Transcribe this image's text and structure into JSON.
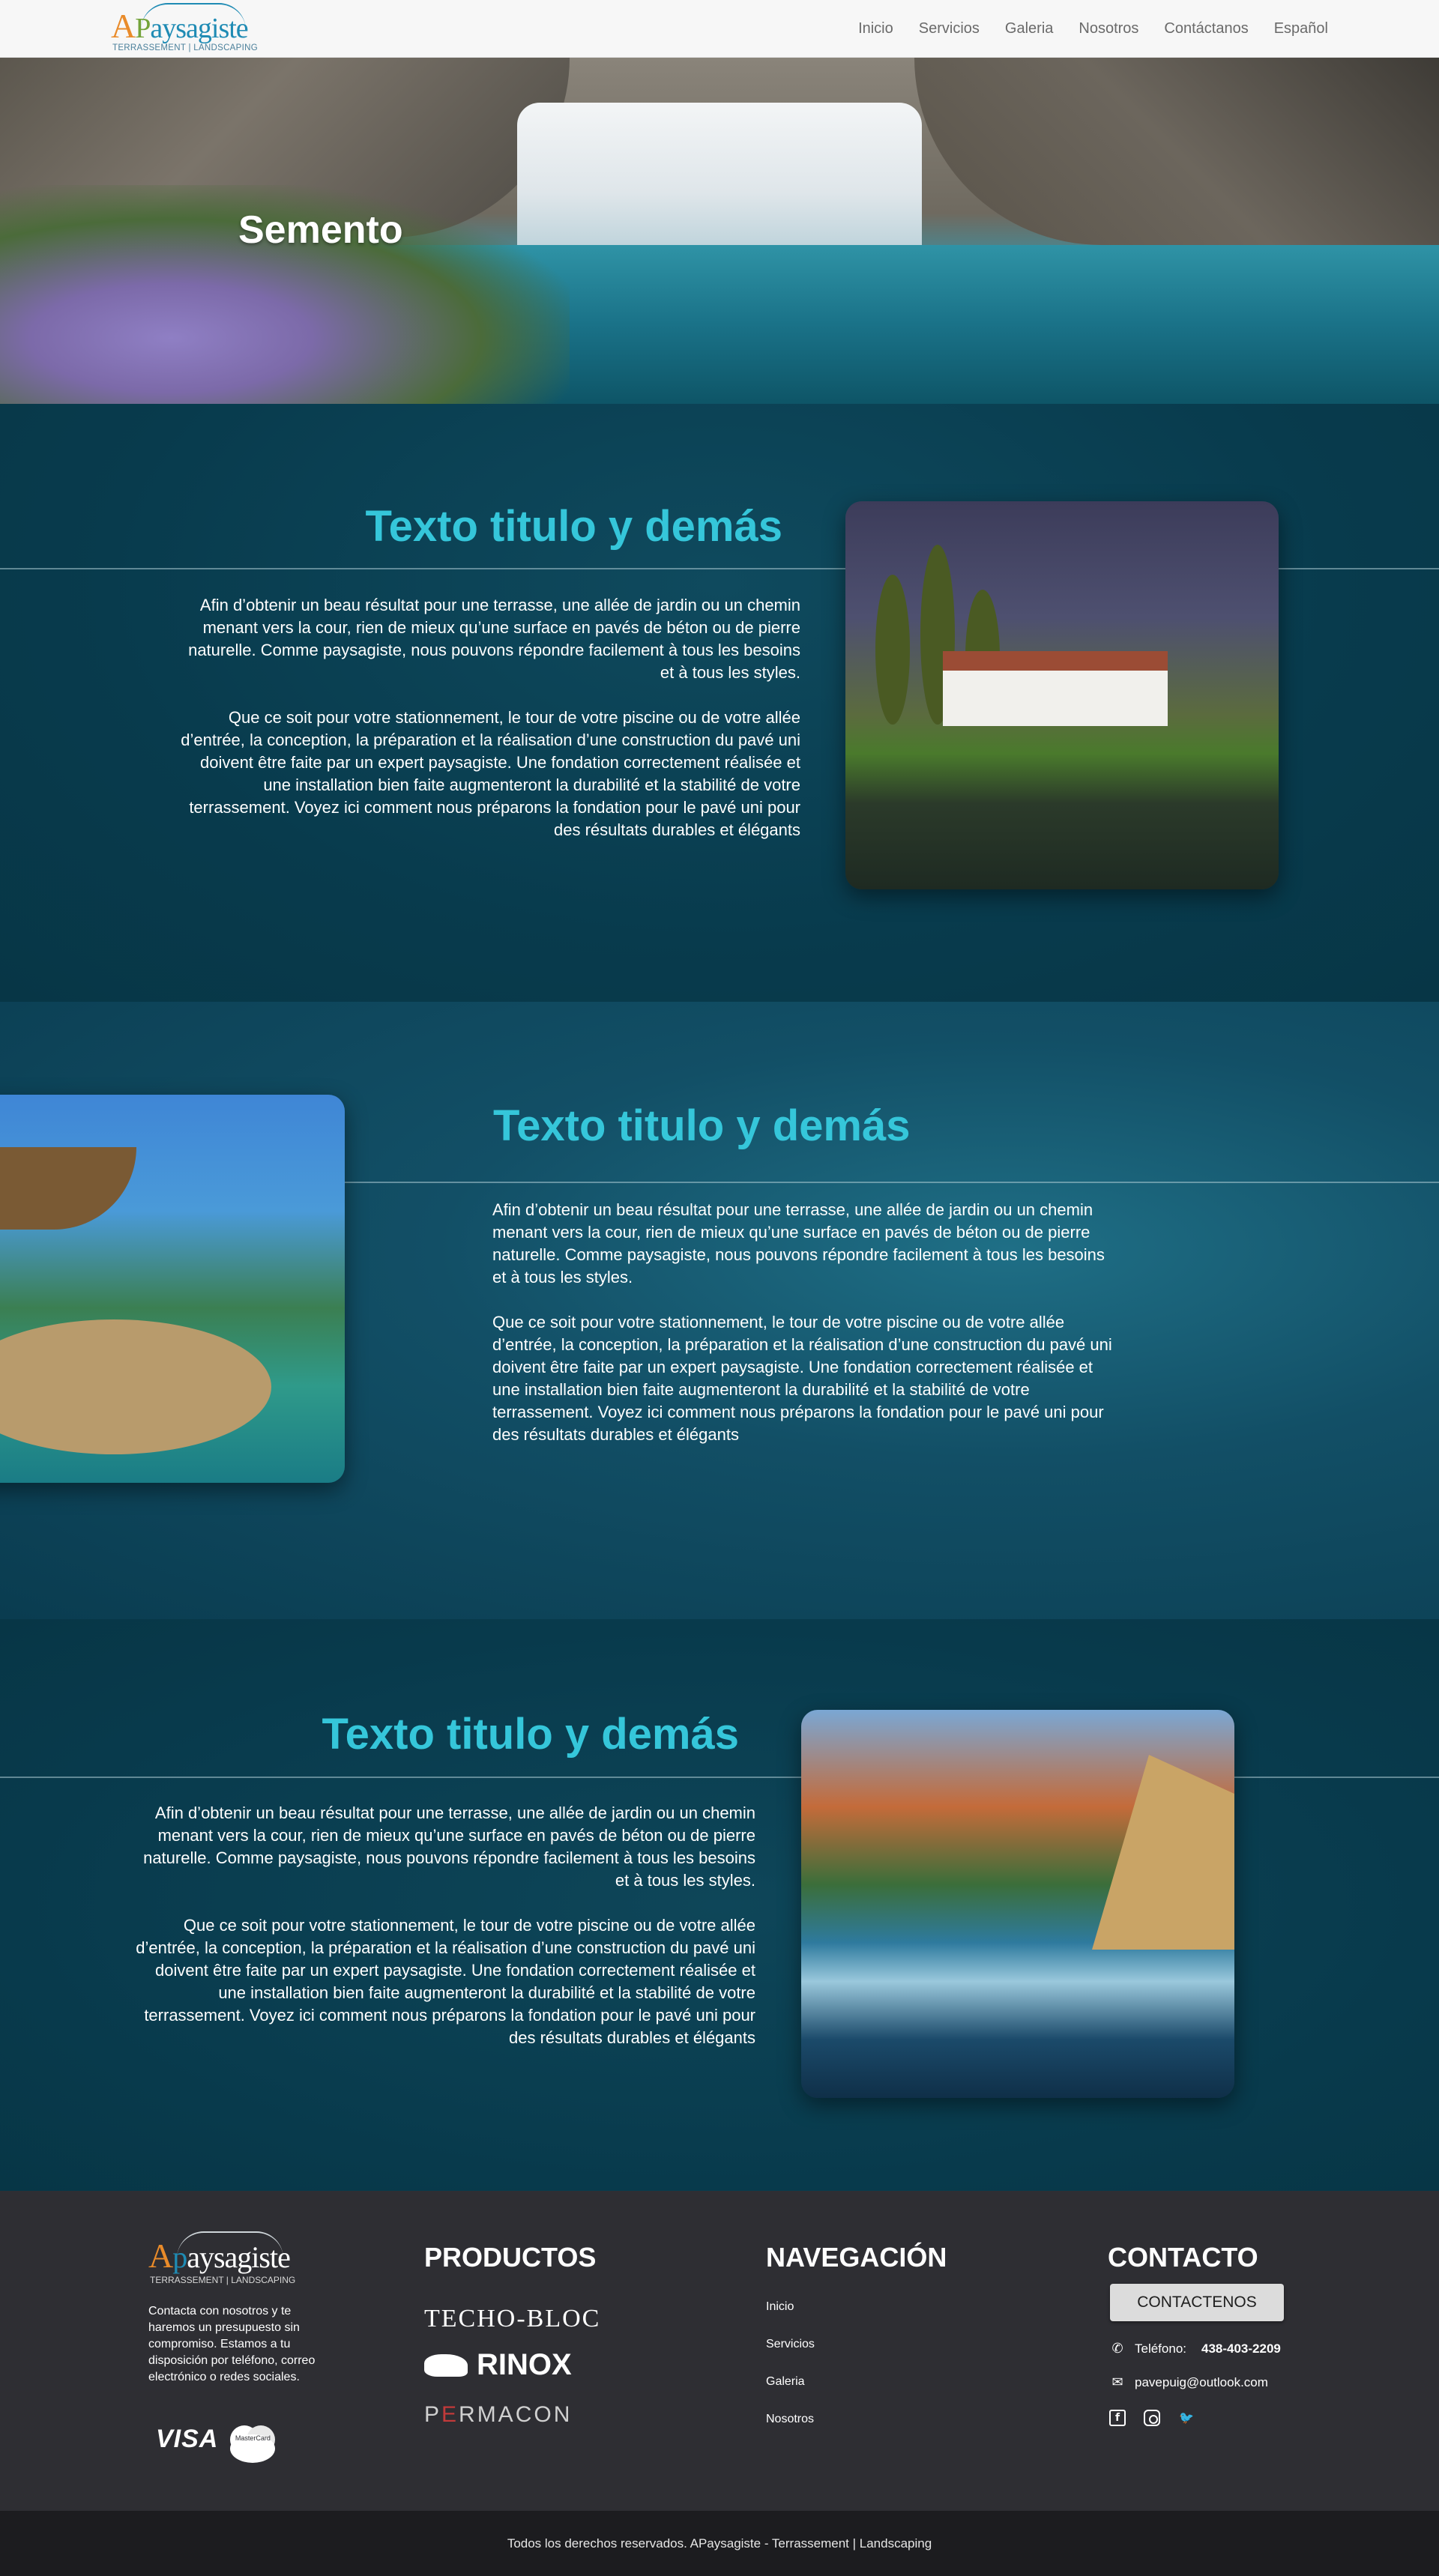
{
  "header": {
    "logo": {
      "text_a": "A",
      "text_p": "P",
      "text_rest": "aysagiste",
      "subtitle": "TERRASSEMENT | LANDSCAPING"
    },
    "nav": [
      "Inicio",
      "Servicios",
      "Galeria",
      "Nosotros",
      "Contáctanos",
      "Español"
    ]
  },
  "hero": {
    "title": "Semento"
  },
  "sections": [
    {
      "title": "Texto titulo y demás",
      "paragraphs": [
        "Afin d’obtenir un beau résultat pour une terrasse, une allée de jardin ou un chemin menant vers la cour, rien de mieux qu’une surface en pavés de béton ou de pierre naturelle. Comme paysagiste, nous pouvons répondre facilement à tous les besoins et à tous les styles.",
        "Que ce soit pour votre stationnement, le tour de votre piscine ou de votre allée d’entrée, la conception, la préparation et la réalisation d’une construction du pavé uni doivent être faite par un expert paysagiste. Une fondation correctement réalisée et une installation bien faite augmenteront la durabilité et la stabilité de votre terrassement. Voyez ici comment nous préparons la fondation pour le pavé uni pour des résultats durables et élégants"
      ]
    },
    {
      "title": "Texto titulo y demás",
      "paragraphs": [
        "Afin d’obtenir un beau résultat pour une terrasse, une allée de jardin ou un chemin menant vers la cour, rien de mieux qu’une surface en pavés de béton ou de pierre naturelle. Comme paysagiste, nous pouvons répondre facilement à tous les besoins et à tous les styles.",
        "Que ce soit pour votre stationnement, le tour de votre piscine ou de votre allée d’entrée, la conception, la préparation et la réalisation d’une construction du pavé uni doivent être faite par un expert paysagiste. Une fondation correctement réalisée et une installation bien faite augmenteront la durabilité et la stabilité de votre terrassement. Voyez ici comment nous préparons la fondation pour le pavé uni pour des résultats durables et élégants"
      ]
    },
    {
      "title": "Texto titulo y demás",
      "paragraphs": [
        "Afin d’obtenir un beau résultat pour une terrasse, une allée de jardin ou un chemin menant vers la cour, rien de mieux qu’une surface en pavés de béton ou de pierre naturelle. Comme paysagiste, nous pouvons répondre facilement à tous les besoins et à tous les styles.",
        "Que ce soit pour votre stationnement, le tour de votre piscine ou de votre allée d’entrée, la conception, la préparation et la réalisation d’une construction du pavé uni doivent être faite par un expert paysagiste. Une fondation correctement réalisée et une installation bien faite augmenteront la durabilité et la stabilité de votre terrassement. Voyez ici comment nous préparons la fondation pour le pavé uni pour des résultats durables et élégants"
      ]
    }
  ],
  "footer": {
    "logo": {
      "text_a": "A",
      "text_p": "p",
      "text_rest": "aysagiste",
      "subtitle": "TERRASSEMENT | LANDSCAPING"
    },
    "about": "Contacta con nosotros y te haremos un presupuesto sin compromiso. Estamos a tu disposición por teléfono, correo electrónico o redes sociales.",
    "cards": {
      "visa": "VISA",
      "mastercard": "MasterCard"
    },
    "products": {
      "heading": "PRODUCTOS",
      "brands": {
        "techo_bloc": "TECHO-BLOC",
        "rinox": "RINOX",
        "permacon_p": "P",
        "permacon_r": "E",
        "permacon_rest": "RMACON"
      }
    },
    "navigation": {
      "heading": "NAVEGACIÓN",
      "links": [
        "Inicio",
        "Servicios",
        "Galeria",
        "Nosotros"
      ]
    },
    "contact": {
      "heading": "CONTACTO",
      "button": "CONTACTENOS",
      "phone_label": "Teléfono:",
      "phone": "438-403-2209",
      "email": "pavepuig@outlook.com",
      "social": [
        "facebook-icon",
        "instagram-icon",
        "twitter-icon"
      ]
    },
    "copyright": "Todos los derechos reservados. APaysagiste - Terrassement | Landscaping"
  },
  "colors": {
    "accent": "#35c6da",
    "section_bg": "#083b4d",
    "footer_bg": "#2e2e33",
    "bottom_bar": "#1c1c1f"
  }
}
